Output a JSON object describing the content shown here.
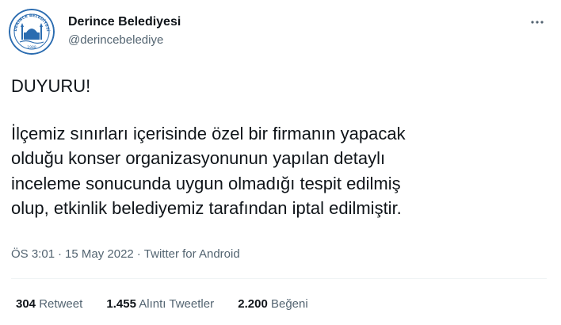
{
  "author": {
    "display_name": "Derince Belediyesi",
    "handle": "@derincebelediye",
    "avatar_icon": "municipality-seal-logo",
    "avatar_text": "DERİNCE BELEDİYESİ",
    "avatar_year": "1988"
  },
  "tweet": {
    "title": "DUYURU!",
    "lines": [
      "İlçemiz sınırları içerisinde özel bir firmanın yapacak",
      "olduğu konser organizasyonunun yapılan detaylı",
      "inceleme sonucunda uygun olmadığı tespit edilmiş",
      "olup, etkinlik belediyemiz tarafından iptal edilmiştir."
    ]
  },
  "meta": {
    "time": "ÖS 3:01",
    "separator": "·",
    "date": "15 May 2022",
    "source": "Twitter for Android"
  },
  "stats": {
    "retweets_count": "304",
    "retweets_label": "Retweet",
    "quotes_count": "1.455",
    "quotes_label": "Alıntı Tweetler",
    "likes_count": "2.200",
    "likes_label": "Beğeni"
  },
  "colors": {
    "text_primary": "#0f1419",
    "text_secondary": "#536471",
    "divider": "#eff3f4",
    "logo_blue": "#2b6cb0"
  },
  "icons": {
    "more": "more-options-icon"
  }
}
